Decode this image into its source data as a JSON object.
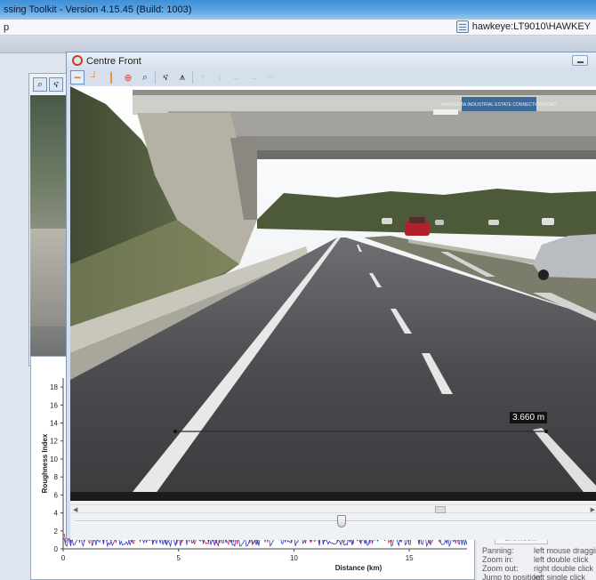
{
  "app": {
    "title": "ssing Toolkit - Version 4.15.45  (Build: 1003)",
    "menu_fragment": "p",
    "connection": "hawkeye:LT9010\\HAWKEY"
  },
  "left_panel": {
    "tools": [
      "zoom-tool",
      "pan-tool"
    ]
  },
  "window": {
    "title": "Centre Front",
    "toolbar": [
      "horizontal-measure-icon",
      "corner-measure-icon",
      "vertical-measure-icon",
      "target-icon",
      "zoom-icon",
      "road-icon",
      "area-icon",
      "arrow-up-icon",
      "arrow-down-icon",
      "arrow-left-icon",
      "arrow-right-icon",
      "link-icon"
    ]
  },
  "scene": {
    "sign_text": "NARANGBA INDUSTRIAL ESTATE CONNECTION ROAD",
    "measurement_label": "3.660 m"
  },
  "slider": {
    "position_fraction": 0.51
  },
  "chart_data": {
    "type": "line",
    "ylabel": "Roughness Index",
    "xlabel": "Distance (km)",
    "xlim": [
      0,
      17.5
    ],
    "ylim": [
      0,
      19
    ],
    "xticks": [
      0,
      5,
      10,
      15
    ],
    "yticks": [
      0,
      2,
      4,
      6,
      8,
      10,
      12,
      14,
      16,
      18
    ],
    "series": [
      {
        "color": "#e0202a",
        "approx_range": [
          0.5,
          2.5
        ]
      },
      {
        "color": "#2a3acc",
        "approx_range": [
          0.3,
          1.8
        ]
      }
    ]
  },
  "help": {
    "browse_label": "Browse...",
    "rows": [
      {
        "key": "Panning:",
        "value": "left mouse dragging"
      },
      {
        "key": "Zoom in:",
        "value": "left double click"
      },
      {
        "key": "Zoom out:",
        "value": "right double click"
      },
      {
        "key": "Jump to position:",
        "value": "left single click"
      }
    ]
  },
  "colors": {
    "accent": "#f08a1c",
    "title_blue": "#3f8fd6"
  }
}
